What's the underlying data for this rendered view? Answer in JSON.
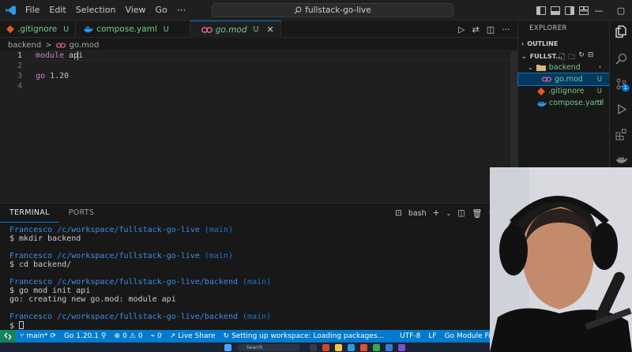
{
  "titlebar": {
    "menus": [
      "File",
      "Edit",
      "Selection",
      "View",
      "Go"
    ],
    "more": "···",
    "search_text": "fullstack-go-live"
  },
  "tabs": [
    {
      "name": ".gitignore",
      "status": "U",
      "icon": "git-icon",
      "color": "#e8562a"
    },
    {
      "name": "compose.yaml",
      "status": "U",
      "icon": "docker-icon",
      "color": "#2496ed"
    },
    {
      "name": "go.mod",
      "status": "U",
      "icon": "go-icon",
      "color": "#e06c9f",
      "active": true
    }
  ],
  "breadcrumb": {
    "folder": "backend",
    "sep": ">",
    "file": "go.mod"
  },
  "editor": {
    "lines": [
      {
        "n": "1",
        "keyword": "module",
        "rest": " api"
      },
      {
        "n": "2",
        "keyword": "",
        "rest": ""
      },
      {
        "n": "3",
        "keyword": "go",
        "rest": " 1.20"
      },
      {
        "n": "4",
        "keyword": "",
        "rest": ""
      }
    ]
  },
  "panel": {
    "tabs": [
      "TERMINAL",
      "PORTS"
    ],
    "shell": "bash",
    "terminal": [
      {
        "user": "Francesco",
        "path": "/c/workspace/fullstack-go-live",
        "branch": "(main)"
      },
      {
        "cmd": "$ mkdir backend"
      },
      {
        "gap": true
      },
      {
        "user": "Francesco",
        "path": "/c/workspace/fullstack-go-live",
        "branch": "(main)"
      },
      {
        "cmd": "$ cd backend/"
      },
      {
        "gap": true
      },
      {
        "user": "Francesco",
        "path": "/c/workspace/fullstack-go-live/backend",
        "branch": "(main)"
      },
      {
        "cmd": "$ go mod init api"
      },
      {
        "cmd": "go: creating new go.mod: module api"
      },
      {
        "gap": true
      },
      {
        "user": "Francesco",
        "path": "/c/workspace/fullstack-go-live/backend",
        "branch": "(main)"
      },
      {
        "cmd": "$ ",
        "cursor": true
      }
    ]
  },
  "sidebar": {
    "title": "EXPLORER",
    "outline": "OUTLINE",
    "workspace": "FULLST...",
    "items": [
      {
        "name": "backend",
        "status": "•",
        "type": "folder"
      },
      {
        "name": "go.mod",
        "status": "U",
        "type": "go",
        "selected": true
      },
      {
        "name": ".gitignore",
        "status": "U",
        "type": "git"
      },
      {
        "name": "compose.yaml",
        "status": "U",
        "type": "docker"
      }
    ]
  },
  "activity": {
    "scm_badge": "1"
  },
  "statusbar": {
    "branch": "main*",
    "go_version": "Go 1.20.1",
    "errors": "0",
    "warnings": "0",
    "ports": "0",
    "live_share": "Live Share",
    "workspace_status": "Setting up workspace: Loading packages...",
    "encoding": "UTF-8",
    "eol": "LF",
    "language": "Go Module File"
  },
  "taskbar": {
    "search": "Search"
  },
  "colors": {
    "accent": "#0078d4",
    "statusbar": "#007acc",
    "untracked": "#73c991"
  }
}
